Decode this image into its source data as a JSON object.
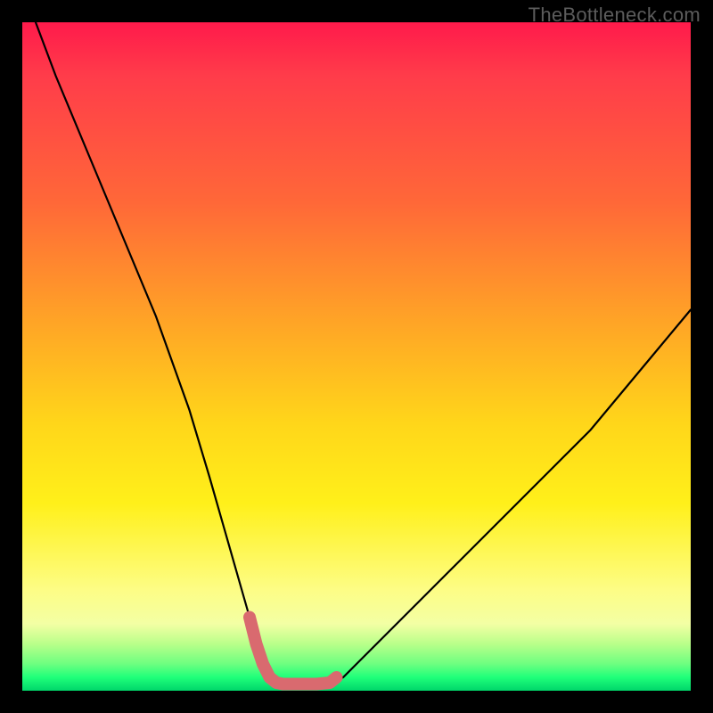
{
  "watermark": "TheBottleneck.com",
  "colors": {
    "frame": "#000000",
    "curve": "#000000",
    "overlay": "#d96a6f"
  },
  "chart_data": {
    "type": "line",
    "title": "",
    "xlabel": "",
    "ylabel": "",
    "xlim": [
      0,
      100
    ],
    "ylim": [
      0,
      100
    ],
    "grid": false,
    "legend": false,
    "description": "V-shaped bottleneck curve over rainbow gradient; minimum near the bottom-center, values rise steeply to the left edge (top-left) and moderately to the right edge.",
    "series": [
      {
        "name": "bottleneck-curve",
        "x": [
          2,
          5,
          10,
          15,
          20,
          25,
          28,
          30,
          32,
          34,
          35,
          36,
          37,
          38,
          39,
          40,
          42,
          44,
          46,
          48,
          50,
          55,
          60,
          65,
          70,
          75,
          80,
          85,
          90,
          95,
          100
        ],
        "y": [
          100,
          92,
          80,
          68,
          56,
          42,
          32,
          25,
          18,
          11,
          7,
          4,
          2,
          1.2,
          1.0,
          1.0,
          1.0,
          1.0,
          1.2,
          2,
          4,
          9,
          14,
          19,
          24,
          29,
          34,
          39,
          45,
          51,
          57
        ]
      }
    ],
    "highlight": {
      "name": "optimal-range-overlay",
      "x": [
        34,
        35,
        36,
        37,
        38,
        39,
        40,
        42,
        44,
        46,
        47
      ],
      "y": [
        11,
        7,
        4,
        2,
        1.2,
        1.0,
        1.0,
        1.0,
        1.0,
        1.2,
        2
      ]
    }
  }
}
